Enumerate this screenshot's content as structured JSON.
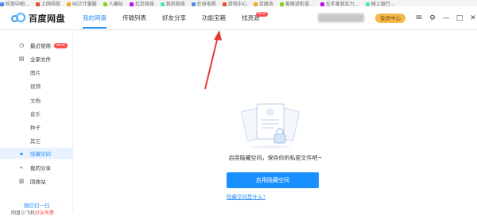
{
  "bookmarks": [
    "吹单中图…",
    "上网导航",
    "NGT计量服",
    "人编站",
    "北京商城",
    "我的商城",
    "在线电视",
    "游戏中心",
    "百度站",
    "美丽说街道…",
    "左手爱我实力…",
    "网上银行…"
  ],
  "app": {
    "logo_text": "百度网盘"
  },
  "nav": {
    "tabs": [
      {
        "label": "我的网盘",
        "active": true
      },
      {
        "label": "传输列表",
        "active": false
      },
      {
        "label": "好友分享",
        "active": false
      },
      {
        "label": "功能宝箱",
        "active": false
      },
      {
        "label": "找资源",
        "active": false,
        "badge": "NEW"
      }
    ]
  },
  "header": {
    "vip_label": "会员中心"
  },
  "sidebar": {
    "items": [
      {
        "label": "最近使用",
        "icon": "clock-icon",
        "badge": "NEW"
      },
      {
        "label": "全部文件",
        "icon": "file-icon"
      },
      {
        "label": "图片"
      },
      {
        "label": "视频"
      },
      {
        "label": "文档"
      },
      {
        "label": "音乐"
      },
      {
        "label": "种子"
      },
      {
        "label": "其它"
      },
      {
        "label": "隐藏空间",
        "icon": "lock-icon",
        "active": true
      },
      {
        "label": "我的分享",
        "icon": "share-icon"
      },
      {
        "label": "回收站",
        "icon": "trash-icon"
      }
    ],
    "wechat_title": "微信扫一扫",
    "wechat_sub_prefix": "网盘小飞机",
    "wechat_sub_highlight": "好友免费"
  },
  "main": {
    "empty_text": "启用隐藏空间，保存你的私密文件吧~",
    "primary_button": "启用隐藏空间",
    "help_link": "隐藏空间是什么?"
  },
  "colors": {
    "accent": "#2b8ff6",
    "primary": "#1a8fff",
    "vip": "#f5b94a",
    "badge": "#ff4d4f"
  }
}
